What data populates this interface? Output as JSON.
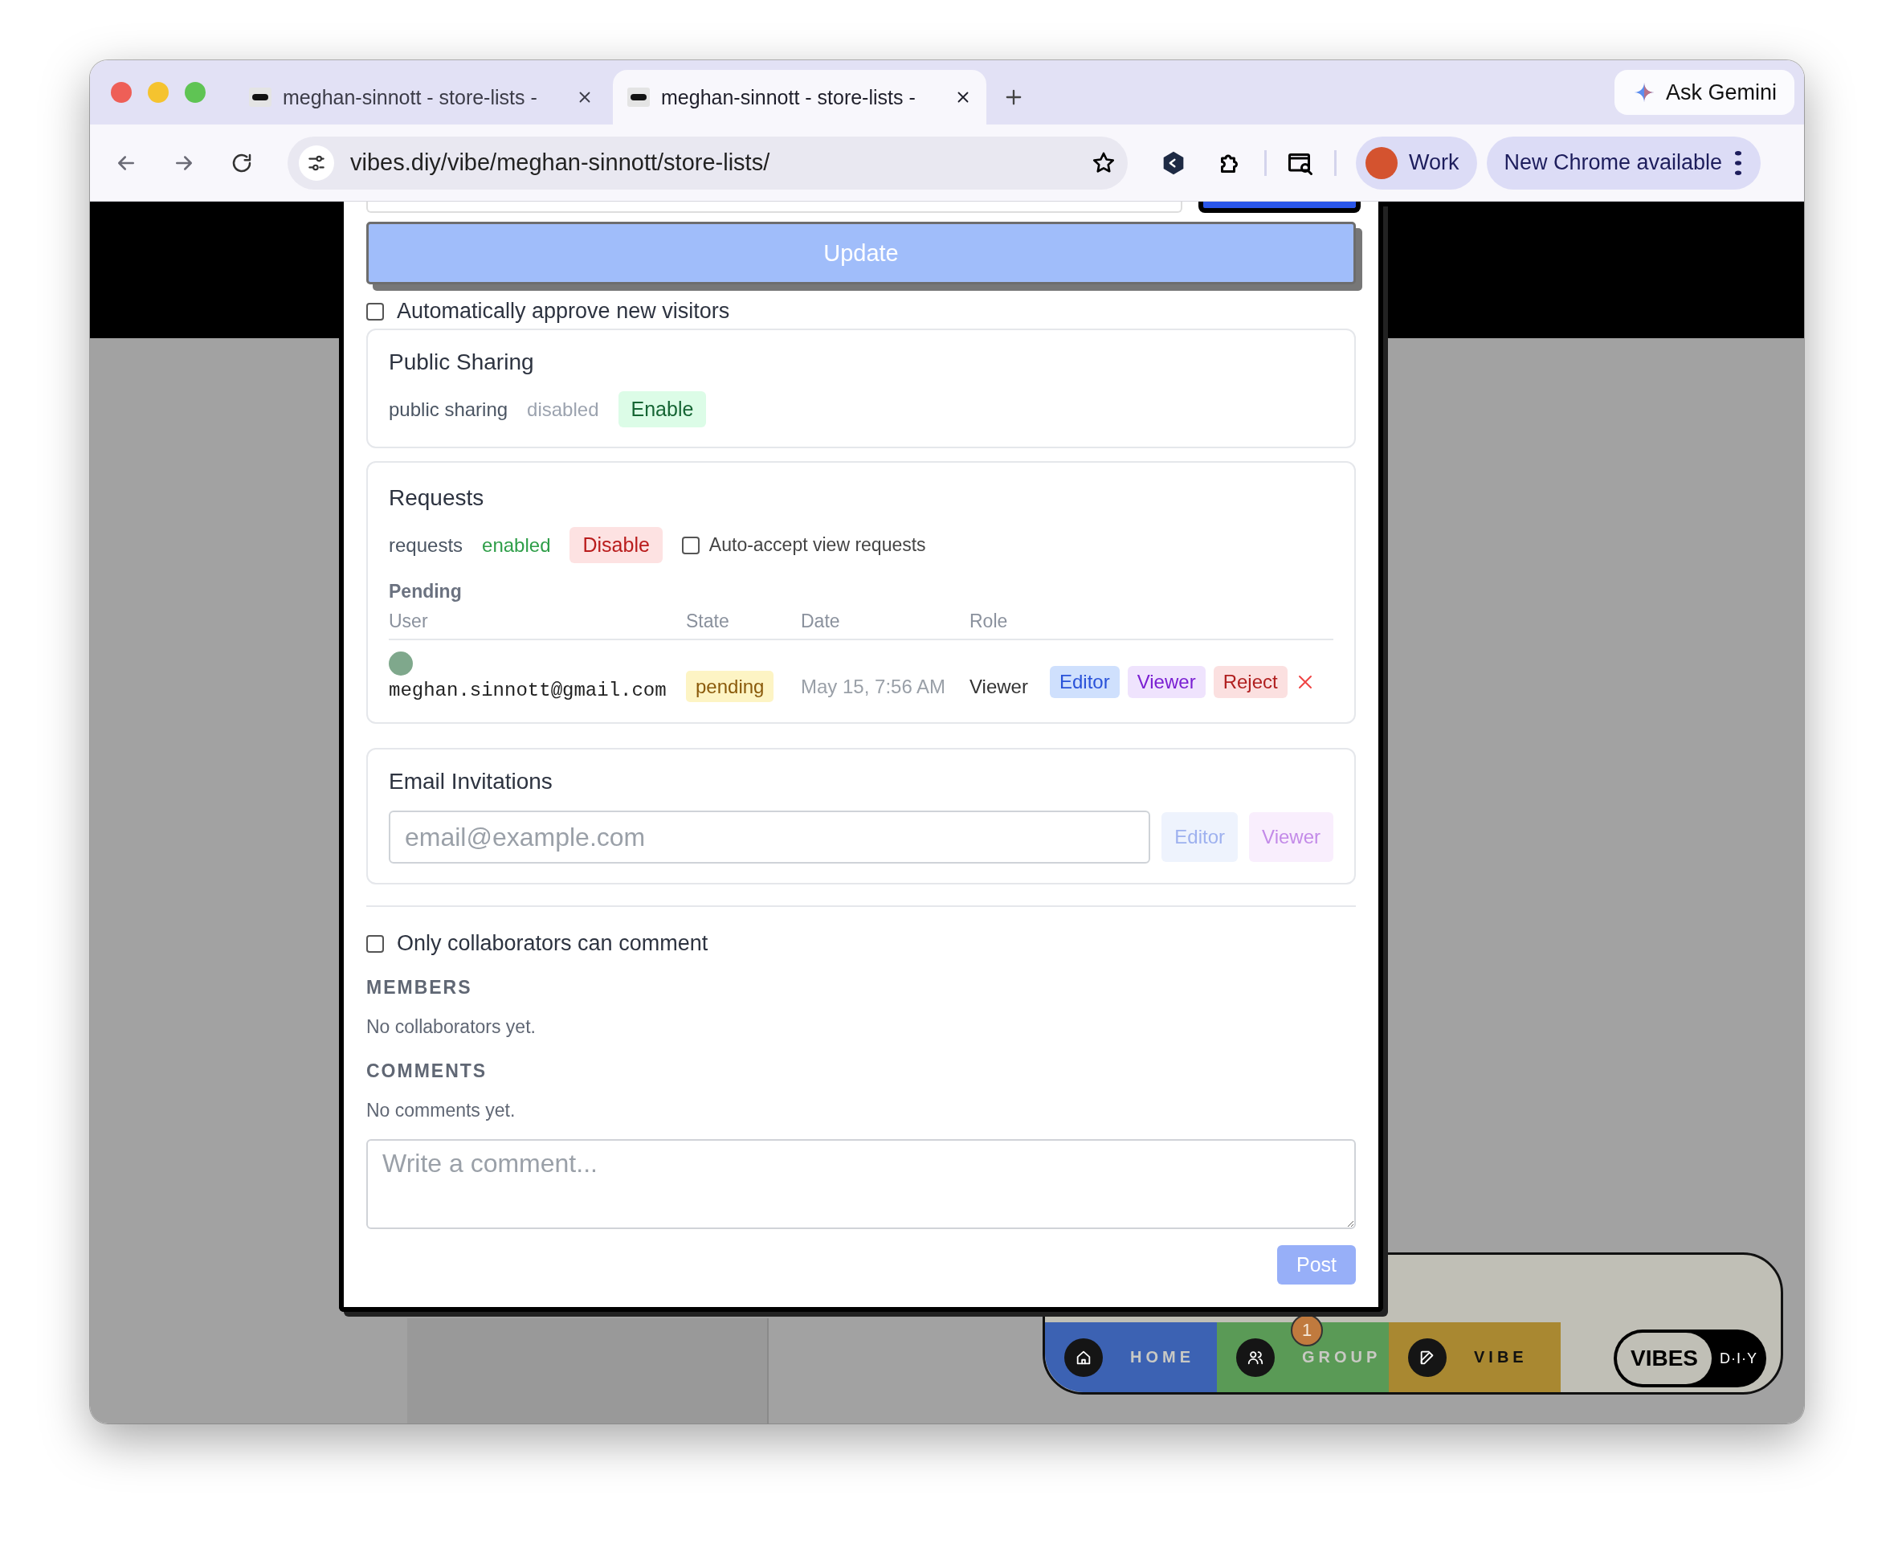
{
  "browser": {
    "tabs": [
      {
        "title": "meghan-sinnott - store-lists -",
        "selected": false
      },
      {
        "title": "meghan-sinnott - store-lists -",
        "selected": true
      }
    ],
    "url": "vibes.diy/vibe/meghan-sinnott/store-lists/",
    "ask_gemini": "Ask Gemini",
    "profile": "Work",
    "update_notice": "New Chrome available"
  },
  "modal": {
    "update_button": "Update",
    "auto_approve": {
      "label": "Automatically approve new visitors",
      "checked": false
    },
    "public_sharing": {
      "title": "Public Sharing",
      "label": "public sharing",
      "status": "disabled",
      "enabled": false,
      "action": "Enable"
    },
    "requests": {
      "title": "Requests",
      "label": "requests",
      "status": "enabled",
      "enabled": true,
      "action": "Disable",
      "auto_accept": {
        "label": "Auto-accept view requests",
        "checked": false
      },
      "pending_title": "Pending",
      "columns": [
        "User",
        "State",
        "Date",
        "Role"
      ],
      "rows": [
        {
          "user": "meghan.sinnott@gmail.com",
          "state": "pending",
          "date": "May 15, 7:56 AM",
          "role": "Viewer",
          "actions": [
            {
              "label": "Editor",
              "kind": "editor"
            },
            {
              "label": "Viewer",
              "kind": "viewer"
            },
            {
              "label": "Reject",
              "kind": "reject"
            }
          ]
        }
      ]
    },
    "email_invitations": {
      "title": "Email Invitations",
      "placeholder": "email@example.com",
      "roles": [
        {
          "label": "Editor",
          "kind": "editor"
        },
        {
          "label": "Viewer",
          "kind": "viewer"
        }
      ]
    },
    "comment_restriction": {
      "label": "Only collaborators can comment",
      "checked": false
    },
    "members": {
      "heading": "MEMBERS",
      "empty": "No collaborators yet."
    },
    "comments": {
      "heading": "COMMENTS",
      "empty": "No comments yet.",
      "placeholder": "Write a comment...",
      "post": "Post"
    }
  },
  "nav": {
    "items": [
      {
        "label": "HOME",
        "kind": "home",
        "color": "#3c62b3",
        "selected": false
      },
      {
        "label": "GROUP",
        "kind": "group",
        "color": "#5a9a56",
        "selected": false,
        "badge": "1"
      },
      {
        "label": "VIBE",
        "kind": "vibe",
        "color": "#a98831",
        "selected": true
      }
    ],
    "logo": {
      "main": "VIBES",
      "sub": "D·I·Y"
    }
  }
}
